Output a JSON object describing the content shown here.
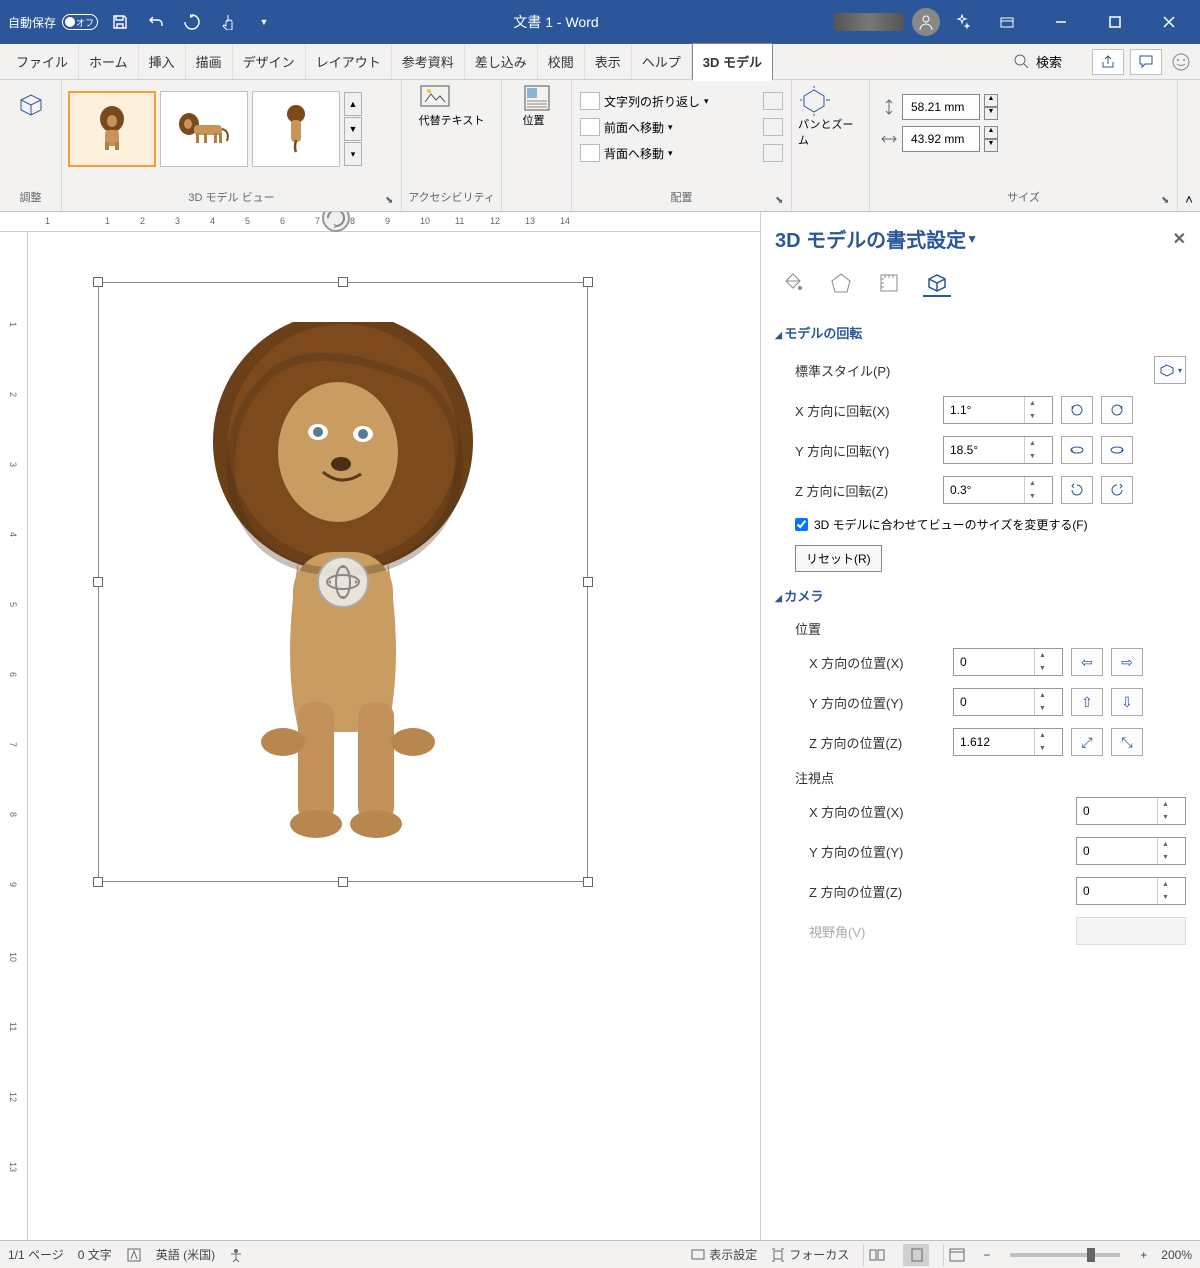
{
  "titlebar": {
    "autosave_label": "自動保存",
    "autosave_state": "オフ",
    "doc_title": "文書 1 - Word"
  },
  "tabs": {
    "file": "ファイル",
    "home": "ホーム",
    "insert": "挿入",
    "draw": "描画",
    "design": "デザイン",
    "layout": "レイアウト",
    "references": "参考資料",
    "mailings": "差し込み",
    "review": "校閲",
    "view": "表示",
    "help": "ヘルプ",
    "model3d": "3D モデル",
    "search": "検索"
  },
  "ribbon": {
    "adjust": {
      "label": "調整"
    },
    "views": {
      "label": "3D モデル ビュー"
    },
    "accessibility": {
      "button": "代替テキスト",
      "label": "アクセシビリティ"
    },
    "position": {
      "button": "位置",
      "label": "配置"
    },
    "arrange": {
      "wrap": "文字列の折り返し",
      "forward": "前面へ移動",
      "backward": "背面へ移動"
    },
    "panzoom": {
      "button": "パンとズーム"
    },
    "size": {
      "height": "58.21 mm",
      "width": "43.92 mm",
      "label": "サイズ"
    }
  },
  "pane": {
    "title": "3D モデルの書式設定",
    "rotation": {
      "header": "モデルの回転",
      "preset_label": "標準スタイル(P)",
      "x_label": "X 方向に回転(X)",
      "y_label": "Y 方向に回転(Y)",
      "z_label": "Z 方向に回転(Z)",
      "x_value": "1.1°",
      "y_value": "18.5°",
      "z_value": "0.3°",
      "fit_label": "3D モデルに合わせてビューのサイズを変更する(F)",
      "reset": "リセット(R)"
    },
    "camera": {
      "header": "カメラ",
      "position": "位置",
      "x_pos_label": "X 方向の位置(X)",
      "y_pos_label": "Y 方向の位置(Y)",
      "z_pos_label": "Z 方向の位置(Z)",
      "x_pos": "0",
      "y_pos": "0",
      "z_pos": "1.612",
      "lookat": "注視点",
      "look_x_label": "X 方向の位置(X)",
      "look_y_label": "Y 方向の位置(Y)",
      "look_z_label": "Z 方向の位置(Z)",
      "look_x": "0",
      "look_y": "0",
      "look_z": "0",
      "fov_label": "視野角(V)"
    }
  },
  "statusbar": {
    "page": "1/1 ページ",
    "words": "0 文字",
    "lang": "英語 (米国)",
    "display_settings": "表示設定",
    "focus": "フォーカス",
    "zoom": "200%"
  }
}
